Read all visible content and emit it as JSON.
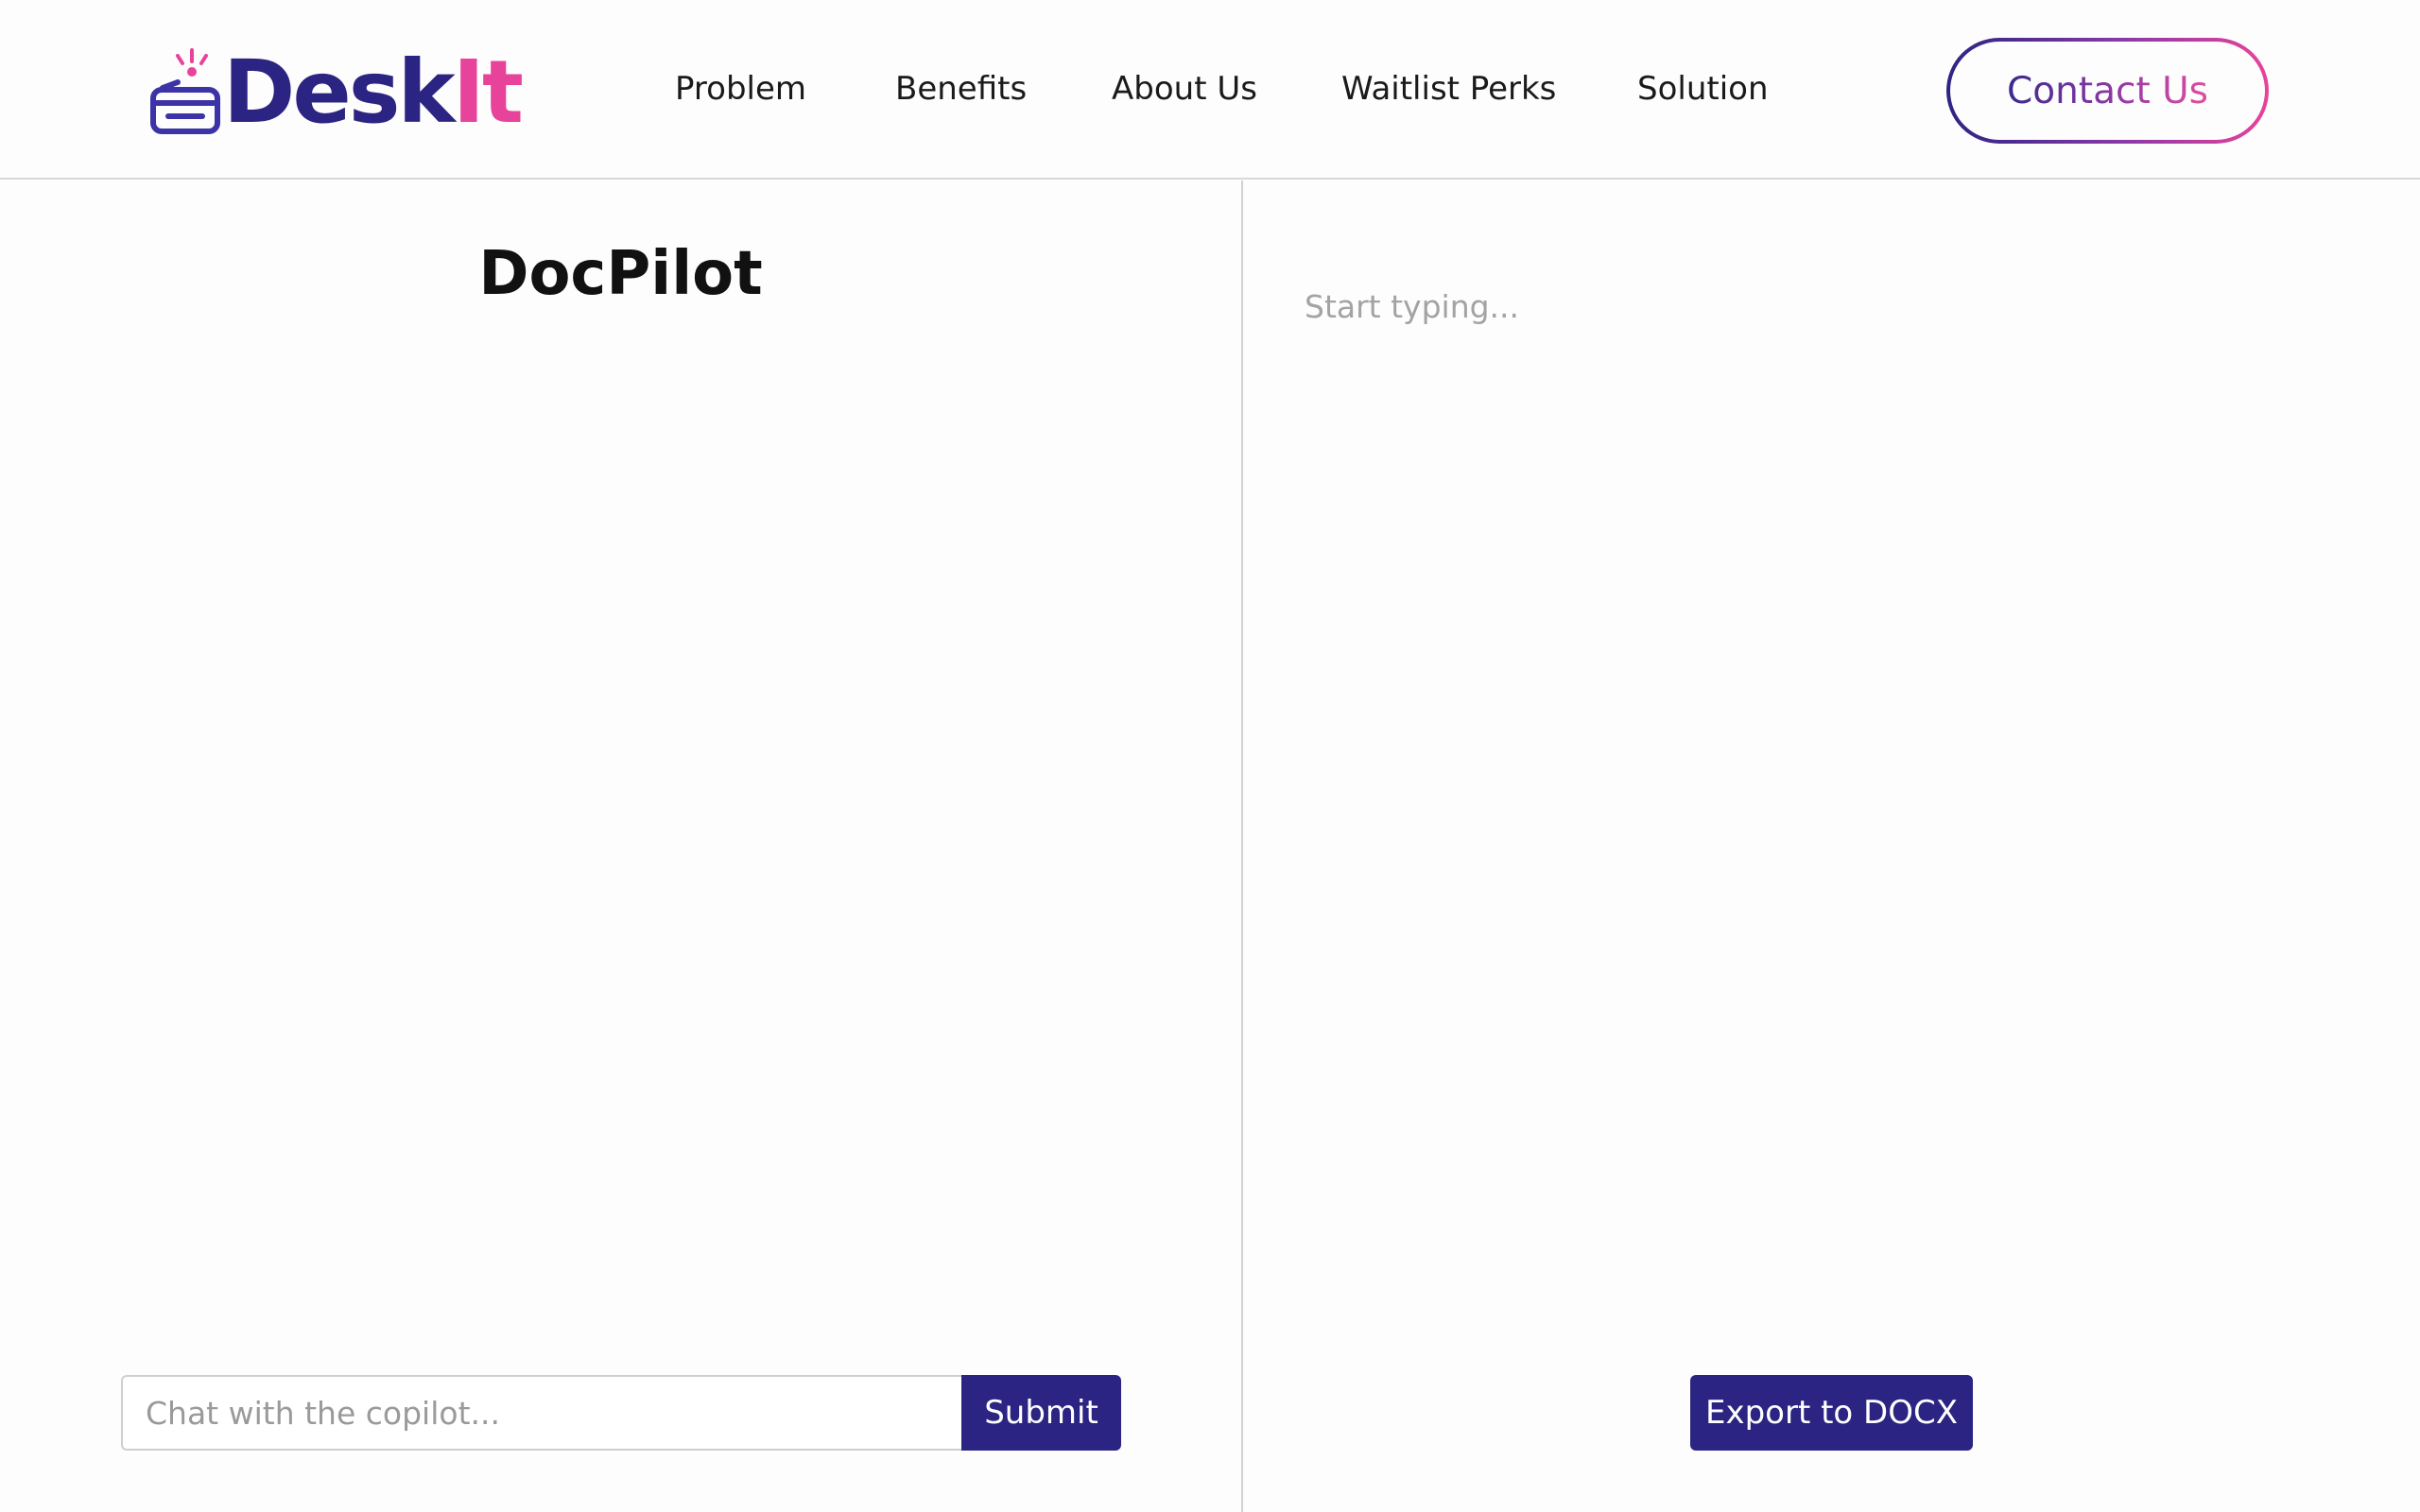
{
  "header": {
    "logo": {
      "part1": "Desk",
      "part2": "It"
    },
    "nav": [
      {
        "label": "Problem"
      },
      {
        "label": "Benefits"
      },
      {
        "label": "About Us"
      },
      {
        "label": "Waitlist Perks"
      },
      {
        "label": "Solution"
      }
    ],
    "contact_label": "Contact Us"
  },
  "left_pane": {
    "title": "DocPilot",
    "chat_placeholder": "Chat with the copilot...",
    "chat_value": "",
    "submit_label": "Submit"
  },
  "right_pane": {
    "editor_placeholder": "Start typing...",
    "editor_value": "",
    "export_label": "Export to DOCX"
  },
  "colors": {
    "brand_navy": "#2c2482",
    "brand_pink": "#e8439a",
    "divider": "#d2d2d2"
  }
}
